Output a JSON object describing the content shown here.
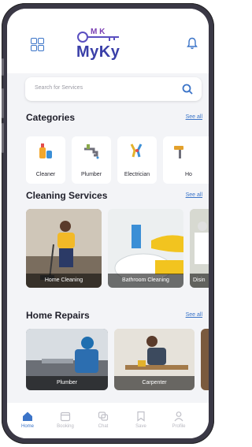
{
  "app": {
    "title": "MyKy",
    "title_top": "M K"
  },
  "colors": {
    "accent": "#3b74c8",
    "brand": "#3a3fa8",
    "logo_accent": "#7b3fb3"
  },
  "icons": {
    "menu": "grid-icon",
    "notify": "bell-icon",
    "search": "search-icon"
  },
  "search": {
    "placeholder": "Search for Services"
  },
  "categories": {
    "title": "Categories",
    "see_all": "See all",
    "items": [
      {
        "label": "Cleaner",
        "icon": "cleaning-supplies-icon"
      },
      {
        "label": "Plumber",
        "icon": "faucet-icon"
      },
      {
        "label": "Electrician",
        "icon": "plug-icon"
      },
      {
        "label": "Ho",
        "icon": "roller-icon"
      }
    ]
  },
  "cleaning": {
    "title": "Cleaning Services",
    "see_all": "See all",
    "items": [
      {
        "label": "Home Cleaning"
      },
      {
        "label": "Bathroom Cleaning"
      },
      {
        "label": "Disin"
      }
    ]
  },
  "repairs": {
    "title": "Home Repairs",
    "see_all": "See all",
    "items": [
      {
        "label": "Plumber"
      },
      {
        "label": "Carpenter"
      }
    ]
  },
  "nav": {
    "items": [
      {
        "label": "Home",
        "icon": "home-icon"
      },
      {
        "label": "Booking",
        "icon": "calendar-icon"
      },
      {
        "label": "Chat",
        "icon": "chat-icon"
      },
      {
        "label": "Save",
        "icon": "bookmark-icon"
      },
      {
        "label": "Profile",
        "icon": "user-icon"
      }
    ]
  }
}
